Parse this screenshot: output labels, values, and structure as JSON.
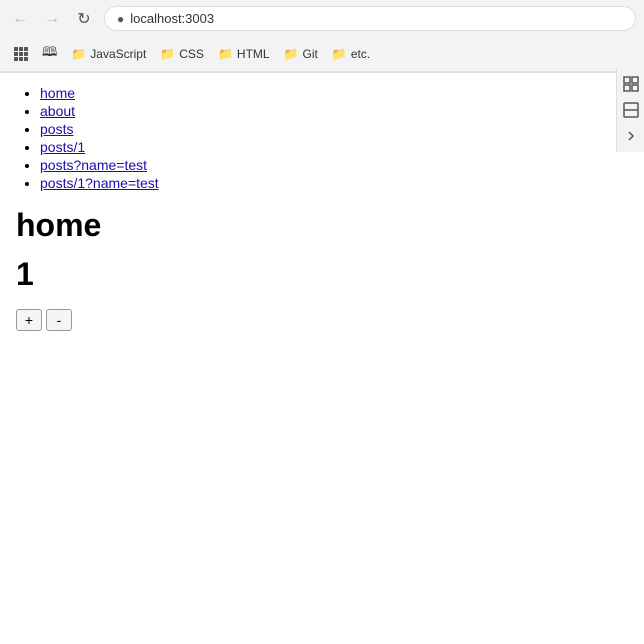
{
  "browser": {
    "url": "localhost:3003",
    "back_btn": "←",
    "forward_btn": "→",
    "reload_btn": "↻"
  },
  "bookmarks": [
    {
      "id": "apps",
      "label": ""
    },
    {
      "id": "reading-list",
      "label": ""
    },
    {
      "id": "javascript",
      "label": "JavaScript"
    },
    {
      "id": "css",
      "label": "CSS"
    },
    {
      "id": "html",
      "label": "HTML"
    },
    {
      "id": "git",
      "label": "Git"
    },
    {
      "id": "etc",
      "label": "etc."
    }
  ],
  "nav_links": [
    {
      "href": "home",
      "label": "home"
    },
    {
      "href": "about",
      "label": "about"
    },
    {
      "href": "posts",
      "label": "posts"
    },
    {
      "href": "posts/1",
      "label": "posts/1"
    },
    {
      "href": "posts?name=test",
      "label": "posts?name=test"
    },
    {
      "href": "posts/1?name=test",
      "label": "posts/1?name=test"
    }
  ],
  "page": {
    "title": "home",
    "counter": "1",
    "plus_btn": "+",
    "minus_btn": "-"
  }
}
